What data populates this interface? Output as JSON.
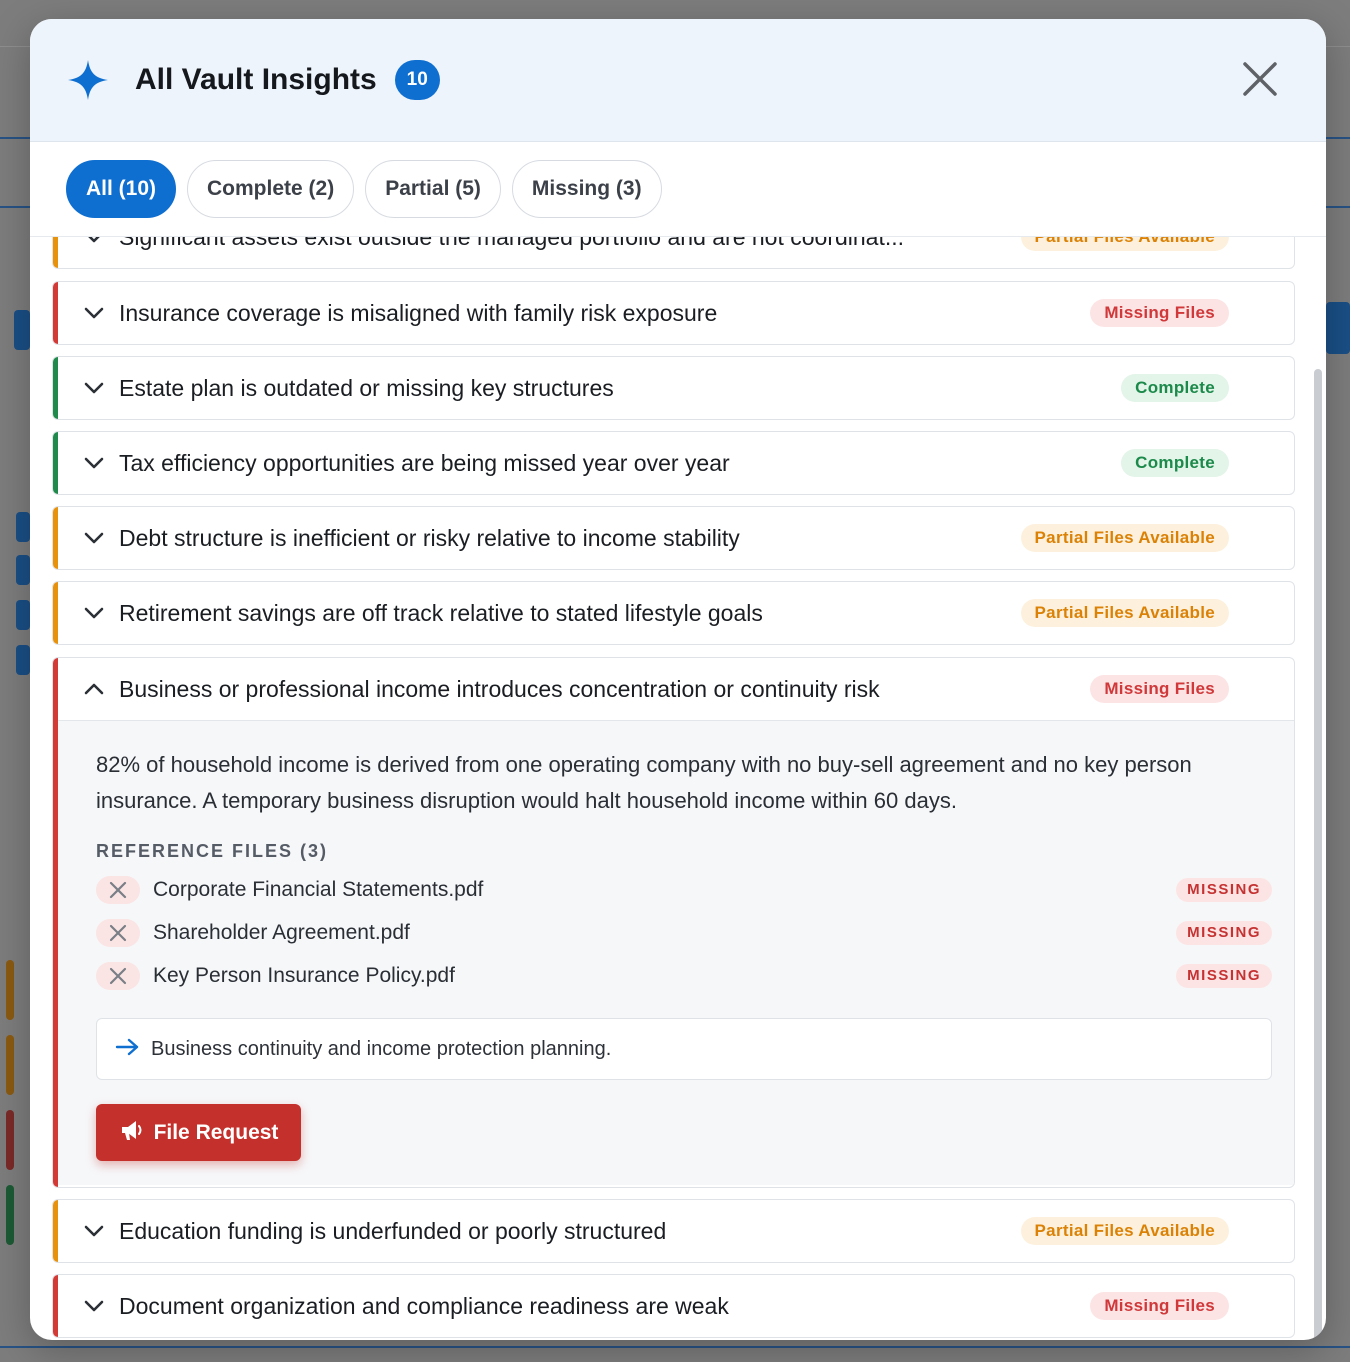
{
  "header": {
    "title": "All Vault Insights",
    "count": "10"
  },
  "tabs": [
    {
      "label": "All (10)",
      "active": true
    },
    {
      "label": "Complete (2)",
      "active": false
    },
    {
      "label": "Partial (5)",
      "active": false
    },
    {
      "label": "Missing (3)",
      "active": false
    }
  ],
  "insights": [
    {
      "title": "Significant assets exist outside the managed portfolio and are not coordinat...",
      "status": "Partial Files Available",
      "type": "partial"
    },
    {
      "title": "Insurance coverage is misaligned with family risk exposure",
      "status": "Missing Files",
      "type": "missing"
    },
    {
      "title": "Estate plan is outdated or missing key structures",
      "status": "Complete",
      "type": "complete"
    },
    {
      "title": "Tax efficiency opportunities are being missed year over year",
      "status": "Complete",
      "type": "complete"
    },
    {
      "title": "Debt structure is inefficient or risky relative to income stability",
      "status": "Partial Files Available",
      "type": "partial"
    },
    {
      "title": "Retirement savings are off track relative to stated lifestyle goals",
      "status": "Partial Files Available",
      "type": "partial"
    },
    {
      "title": "Business or professional income introduces concentration or continuity risk",
      "status": "Missing Files",
      "type": "missing",
      "expanded": true
    },
    {
      "title": "Education funding is underfunded or poorly structured",
      "status": "Partial Files Available",
      "type": "partial"
    },
    {
      "title": "Document organization and compliance readiness are weak",
      "status": "Missing Files",
      "type": "missing"
    }
  ],
  "expanded": {
    "description": "82% of household income is derived from one operating company with no buy-sell agreement and no key person insurance. A temporary business disruption would halt household income within 60 days.",
    "ref_heading": "REFERENCE FILES (3)",
    "files": [
      {
        "name": "Corporate Financial Statements.pdf",
        "tag": "MISSING"
      },
      {
        "name": "Shareholder Agreement.pdf",
        "tag": "MISSING"
      },
      {
        "name": "Key Person Insurance Policy.pdf",
        "tag": "MISSING"
      }
    ],
    "recommendation": "Business continuity and income protection planning.",
    "button_label": "File Request"
  },
  "colors": {
    "accent": "#0f6fd0",
    "partial": "#e8920b",
    "missing": "#d33a36",
    "complete": "#1f8a4b",
    "file_request": "#c4302b"
  }
}
